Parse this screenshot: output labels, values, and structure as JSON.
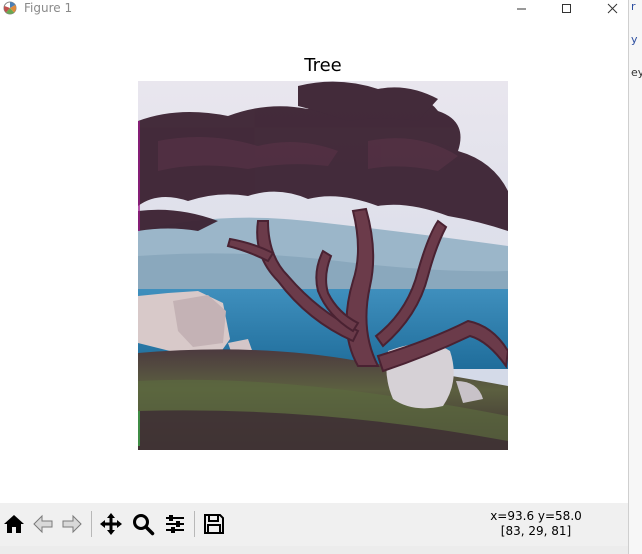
{
  "window": {
    "title": "Figure 1",
    "controls": {
      "minimize": "minimize",
      "maximize": "maximize",
      "close": "close"
    }
  },
  "figure": {
    "title": "Tree",
    "image": {
      "description_icon": "tree-photo"
    }
  },
  "toolbar": {
    "buttons": [
      {
        "name": "home",
        "icon": "home-icon",
        "enabled": true
      },
      {
        "name": "back",
        "icon": "back-arrow-icon",
        "enabled": false
      },
      {
        "name": "forward",
        "icon": "forward-arrow-icon",
        "enabled": false
      },
      {
        "name": "pan",
        "icon": "pan-icon",
        "enabled": true
      },
      {
        "name": "zoom",
        "icon": "zoom-icon",
        "enabled": true
      },
      {
        "name": "configure",
        "icon": "sliders-icon",
        "enabled": true
      },
      {
        "name": "save",
        "icon": "save-icon",
        "enabled": true
      }
    ],
    "coords_line1": "x=93.6 y=58.0",
    "coords_line2": "[83, 29, 81]"
  },
  "background_fragments": [
    "r",
    "y",
    "ey"
  ]
}
